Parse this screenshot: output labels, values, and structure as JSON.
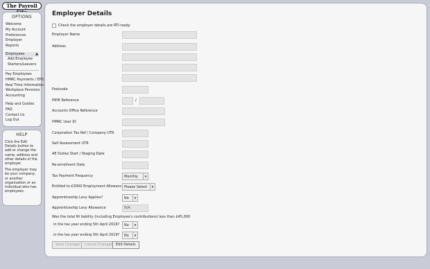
{
  "site": {
    "logo_text": "The Payroll Site"
  },
  "options": {
    "title": "OPTIONS",
    "group1": [
      "Welcome",
      "My Account",
      "Preferences",
      "Employer",
      "Reports"
    ],
    "employees_section": "Employees",
    "employees_sub": [
      "Add Employee",
      "Starters/Leavers"
    ],
    "group2": [
      "Pay Employees",
      "HMRC Payments / EPS",
      "Real Time Information",
      "Workplace Pensions",
      "Accounting"
    ],
    "group3": [
      "Help and Guides",
      "FAQ",
      "Contact Us",
      "Log Out"
    ]
  },
  "help": {
    "title": "HELP",
    "p1": "Click the Edit Details button to add or change the name, address and other details of the employer.",
    "p2": "The employer may be your company, or another organisation or an individual who has employees."
  },
  "form": {
    "title": "Employer Details",
    "rti_check_label": "Check the employer details are RTI-ready",
    "employer_name_label": "Employer Name",
    "address_label": "Address",
    "postcode_label": "Postcode",
    "paye_label": "PAYE Reference",
    "paye_sep": "/",
    "accounts_office_label": "Accounts Office Reference",
    "hmrc_user_label": "HMRC User ID",
    "corp_tax_label": "Corporation Tax Ref / Company UTR",
    "self_assess_label": "Self Assessment UTR",
    "ae_duties_label": "AE Duties Start / Staging Date",
    "reenrol_label": "Re-enrolment Date",
    "tax_freq_label": "Tax Payment Frequency",
    "tax_freq_value": "Monthly",
    "allowance_label": "Entitled to £3000 Employment Allowance?",
    "allowance_value": "Please Select",
    "levy_applies_label": "Apprenticeship Levy Applies?",
    "levy_applies_value": "No",
    "levy_allowance_label": "Apprenticeship Levy Allowance",
    "levy_allowance_value": "N/A",
    "ni_question": "Was the total NI liability (including Employee's contributions) less than £45,000",
    "ni_year1_label": "in the tax year ending 5th April 2016?",
    "ni_year1_value": "No",
    "ni_year2_label": "in the tax year ending 5th April 2019?",
    "ni_year2_value": "No",
    "save_button": "Save Changes",
    "cancel_button": "Cancel Changes",
    "edit_button": "Edit Details"
  }
}
